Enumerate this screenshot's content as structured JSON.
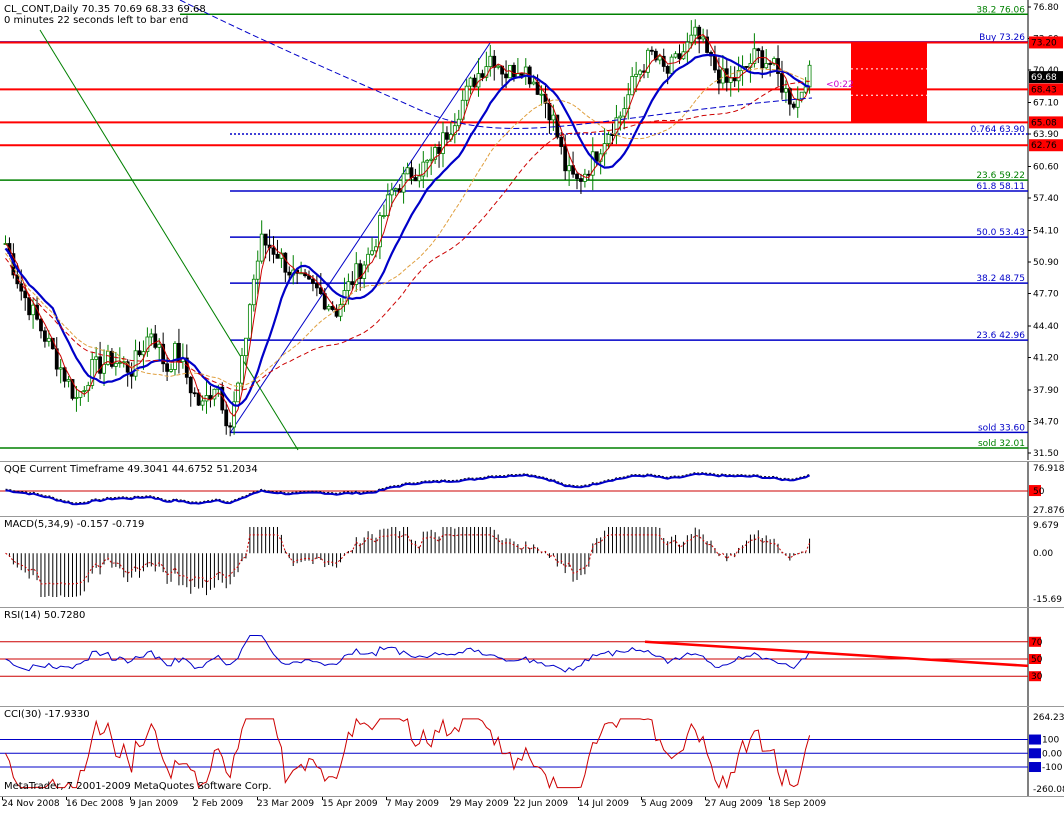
{
  "window": {
    "symbol_header": "CL_CONT,Daily  70.35 70.69 68.33 69.68",
    "timer": "0 minutes 22 seconds left to bar end",
    "copyright": "MetaTrader, 7 2001-2009 MetaQuotes Software Corp."
  },
  "colors": {
    "background": "#ffffff",
    "fib_blue": "#0000c8",
    "sr_red": "#ff0000",
    "green_line": "#008000",
    "price_label_red": "#ff0000",
    "price_label_dark": "#000000",
    "zone_red": "#ff0000"
  },
  "main_pane": {
    "price_scale": [
      "76.80",
      "73.60",
      "70.40",
      "67.10",
      "63.90",
      "60.60",
      "57.40",
      "54.10",
      "50.90",
      "47.70",
      "44.40",
      "41.20",
      "37.90",
      "34.70",
      "31.50"
    ],
    "ylim": [
      31.5,
      76.8
    ],
    "current_price": "69.68",
    "tagged_prices": [
      {
        "value": "73.20",
        "type": "red"
      },
      {
        "value": "68.43",
        "type": "red"
      },
      {
        "value": "65.08",
        "type": "red"
      },
      {
        "value": "62.76",
        "type": "red"
      }
    ],
    "horizontal_levels": [
      {
        "label": "38.2  76.06",
        "price": 76.06,
        "color": "green"
      },
      {
        "label": "Buy 73.26",
        "price": 73.26,
        "color": "blue"
      },
      {
        "label": "0.764  63.90",
        "price": 63.9,
        "color": "blue",
        "dashed": true
      },
      {
        "label": "23.6  59.22",
        "price": 59.22,
        "color": "green"
      },
      {
        "label": "61.8  58.11",
        "price": 58.11,
        "color": "blue"
      },
      {
        "label": "50.0  53.43",
        "price": 53.43,
        "color": "blue"
      },
      {
        "label": "38.2  48.75",
        "price": 48.75,
        "color": "blue"
      },
      {
        "label": "23.6  42.96",
        "price": 42.96,
        "color": "blue"
      },
      {
        "label": "sold 33.60",
        "price": 33.6,
        "color": "blue"
      },
      {
        "label": "sold 32.01",
        "price": 32.01,
        "color": "green"
      }
    ],
    "red_sr_lines": [
      73.2,
      68.43,
      65.08,
      62.76
    ],
    "marker_text": "<0:22"
  },
  "qqe_pane": {
    "title": "QQE Current Timeframe 49.3041 44.6752 51.2034",
    "scale": [
      "76.918",
      "50",
      "27.8762"
    ]
  },
  "macd_pane": {
    "title": "MACD(5,34,9) -0.157 -0.719",
    "scale": [
      "9.679",
      "0.00",
      "-15.69"
    ]
  },
  "rsi_pane": {
    "title": "RSI(14) 50.7280",
    "scale": [
      "70",
      "50",
      "30"
    ]
  },
  "cci_pane": {
    "title": "CCI(30) -17.9330",
    "scale": [
      "264.236",
      "100",
      "0.00",
      "-100",
      "-260.081"
    ]
  },
  "date_axis": [
    "24 Nov 2008",
    "16 Dec 2008",
    "9 Jan 2009",
    "2 Feb 2009",
    "23 Mar 2009",
    "15 Apr 2009",
    "7 May 2009",
    "29 May 2009",
    "22 Jun 2009",
    "14 Jul 2009",
    "5 Aug 2009",
    "27 Aug 2009",
    "18 Sep 2009"
  ]
}
